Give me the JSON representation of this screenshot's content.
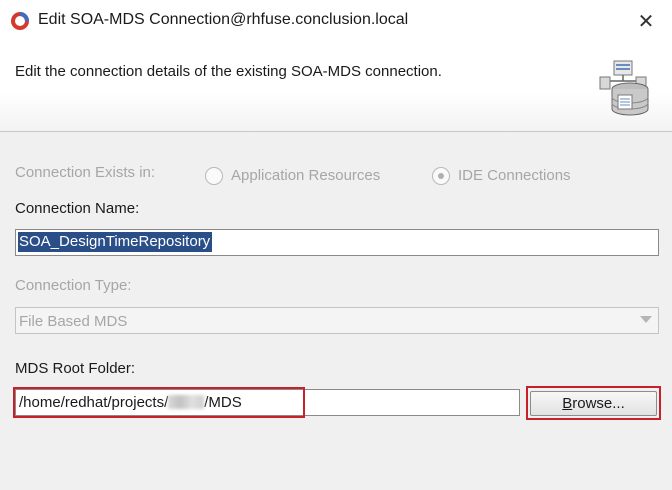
{
  "window": {
    "title": "Edit SOA-MDS Connection@rhfuse.conclusion.local",
    "close_glyph": "✕"
  },
  "header": {
    "description": "Edit the connection details of the existing SOA-MDS connection.",
    "icon": "database-connection-icon"
  },
  "connection_exists": {
    "label": "Connection Exists in:",
    "options": [
      {
        "label": "Application Resources",
        "checked": false
      },
      {
        "label": "IDE Connections",
        "checked": true
      }
    ]
  },
  "connection_name": {
    "label": "Connection Name:",
    "value": "SOA_DesignTimeRepository"
  },
  "connection_type": {
    "label": "Connection Type:",
    "value": "File Based MDS"
  },
  "mds_root_folder": {
    "label": "MDS Root Folder:",
    "value_prefix": "/home/redhat/projects/",
    "value_suffix": "/MDS"
  },
  "browse_button": {
    "label": "Browse..."
  },
  "colors": {
    "highlight": "#c8202a",
    "selection": "#2a4f88",
    "disabled_text": "#a6a6a6"
  }
}
